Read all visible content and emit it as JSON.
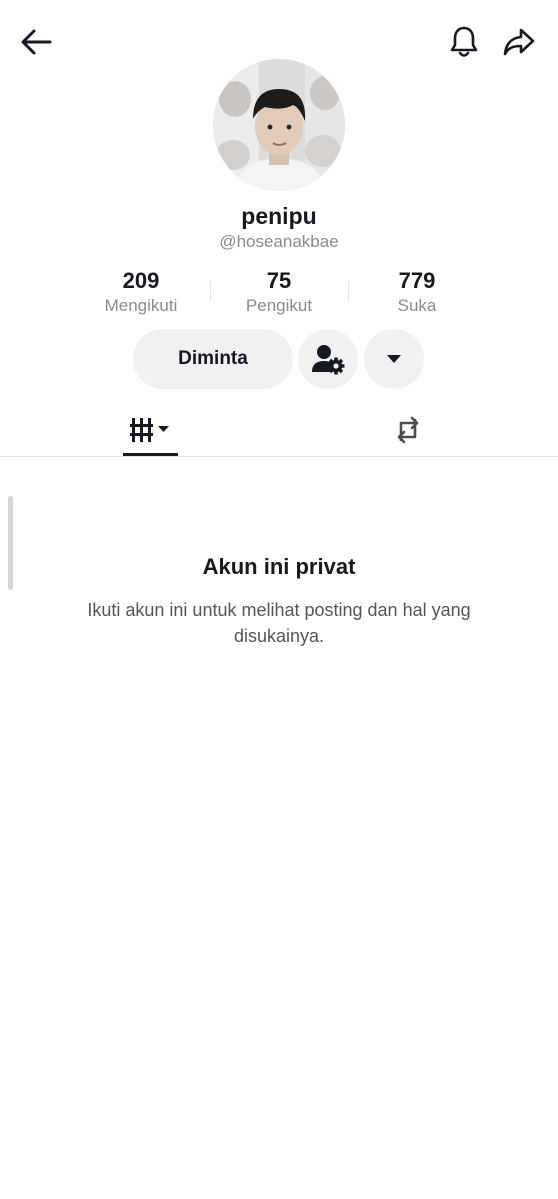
{
  "header": {
    "back_icon": "arrow-left-icon",
    "notification_icon": "bell-icon",
    "share_icon": "share-arrow-icon"
  },
  "profile": {
    "display_name": "penipu",
    "username": "@hoseanakbae",
    "avatar": "profile-photo"
  },
  "stats": {
    "following": {
      "value": "209",
      "label": "Mengikuti"
    },
    "followers": {
      "value": "75",
      "label": "Pengikut"
    },
    "likes": {
      "value": "779",
      "label": "Suka"
    }
  },
  "actions": {
    "requested_label": "Diminta",
    "settings_icon": "user-settings-icon",
    "more_icon": "caret-down-icon"
  },
  "tabs": {
    "videos_icon": "videos-grid-icon",
    "reposts_icon": "repost-icon",
    "active": "videos"
  },
  "private_notice": {
    "title": "Akun ini privat",
    "description": "Ikuti akun ini untuk melihat posting dan hal yang disukainya."
  },
  "colors": {
    "text_primary": "#161823",
    "text_secondary": "#8a8b91",
    "button_bg": "#f1f1f2",
    "divider": "#e3e3e4"
  }
}
